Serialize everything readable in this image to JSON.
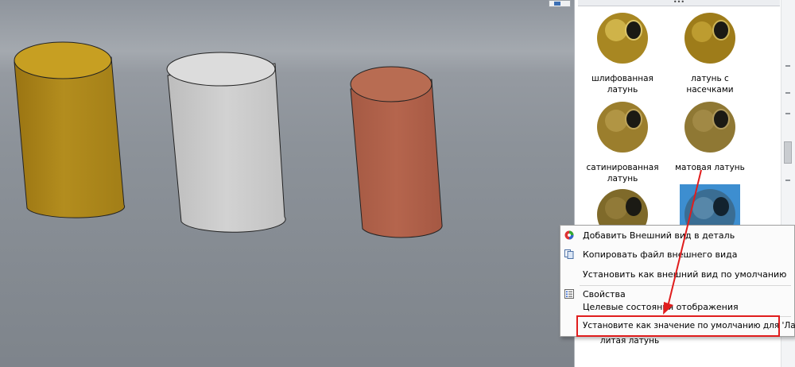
{
  "panel": {
    "materials": [
      {
        "label": "шлифованная латунь"
      },
      {
        "label": "латунь с насечками"
      },
      {
        "label": "сатинированная латунь"
      },
      {
        "label": "матовая латунь"
      }
    ],
    "partial_label": "литая латунь",
    "splitter_glyph": "•••"
  },
  "context_menu": {
    "items": [
      {
        "label": "Добавить Внешний вид в деталь",
        "icon": "add-appearance-icon"
      },
      {
        "label": "Копировать файл внешнего вида",
        "icon": "copy-file-icon"
      },
      {
        "label": "Установить как внешний вид по умолчанию",
        "icon": ""
      },
      {
        "label": "Свойства",
        "icon": "properties-icon"
      },
      {
        "label": "Целевые состояния отображения",
        "icon": ""
      },
      {
        "label": "Установите как значение по умолчанию для 'Латунь'",
        "icon": ""
      }
    ]
  },
  "colors": {
    "viewport_bg": "#8c9299",
    "brass_cylinder": "#b08a1c",
    "silver_cylinder": "#c9c9c9",
    "copper_cylinder": "#b0624a",
    "highlight": "#e01d1d",
    "selected_tile": "#3d8ed0"
  }
}
